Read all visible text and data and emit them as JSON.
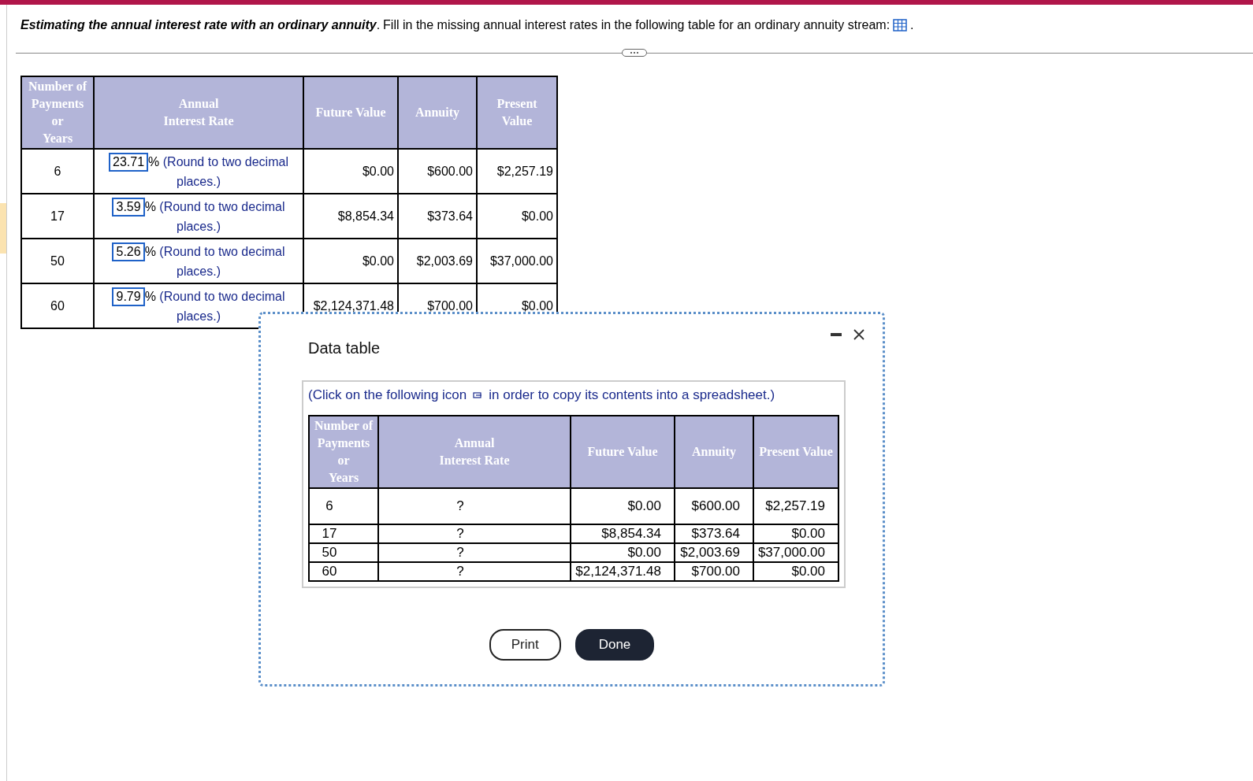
{
  "question": {
    "title": "Estimating the annual interest rate with an ordinary annuity",
    "title_end": ".",
    "text": "Fill in the missing annual interest rates in the following table for an ordinary annuity stream:",
    "end": "."
  },
  "table": {
    "columns": [
      "Number of\nPayments\nor\nYears",
      "Annual\nInterest Rate",
      "Future Value",
      "Annuity",
      "Present\nValue"
    ],
    "rows": [
      {
        "years": "6",
        "answer": "23.71",
        "unit": "%",
        "hint": "(Round to two decimal places.)",
        "future_value": "$0.00",
        "annuity": "$600.00",
        "present_value": "$2,257.19"
      },
      {
        "years": "17",
        "answer": "3.59",
        "unit": "%",
        "hint": "(Round to two decimal places.)",
        "future_value": "$8,854.34",
        "annuity": "$373.64",
        "present_value": "$0.00"
      },
      {
        "years": "50",
        "answer": "5.26",
        "unit": "%",
        "hint": "(Round to two decimal places.)",
        "future_value": "$0.00",
        "annuity": "$2,003.69",
        "present_value": "$37,000.00"
      },
      {
        "years": "60",
        "answer": "9.79",
        "unit": "%",
        "hint": "(Round to two decimal places.)",
        "future_value": "$2,124,371.48",
        "annuity": "$700.00",
        "present_value": "$0.00"
      }
    ]
  },
  "dialog": {
    "title": "Data table",
    "instruction_before": "(Click on the following icon",
    "instruction_after": "in order to copy its contents into a spreadsheet.)",
    "table": {
      "columns": [
        "Number of\nPayments\nor\nYears",
        "Annual\nInterest Rate",
        "Future Value",
        "Annuity",
        "Present Value"
      ],
      "rows": [
        {
          "years": "6",
          "rate": "?",
          "future_value": "$0.00",
          "annuity": "$600.00",
          "present_value": "$2,257.19"
        },
        {
          "years": "17",
          "rate": "?",
          "future_value": "$8,854.34",
          "annuity": "$373.64",
          "present_value": "$0.00"
        },
        {
          "years": "50",
          "rate": "?",
          "future_value": "$0.00",
          "annuity": "$2,003.69",
          "present_value": "$37,000.00"
        },
        {
          "years": "60",
          "rate": "?",
          "future_value": "$2,124,371.48",
          "annuity": "$700.00",
          "present_value": "$0.00"
        }
      ]
    },
    "buttons": [
      {
        "label": "Print",
        "kind": "outline"
      },
      {
        "label": "Done",
        "kind": "primary"
      }
    ]
  }
}
